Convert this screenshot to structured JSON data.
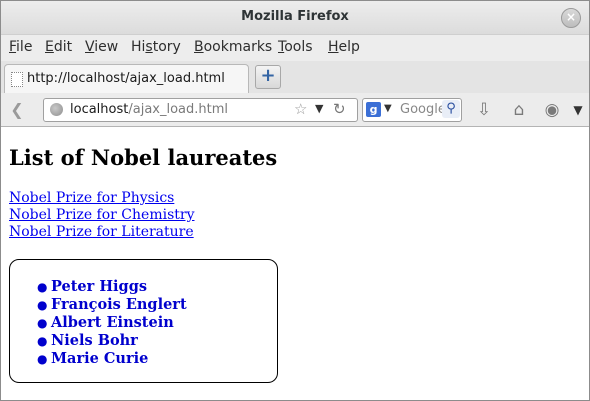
{
  "window": {
    "title": "Mozilla Firefox",
    "close_glyph": "×"
  },
  "menubar": {
    "items": [
      {
        "u": "F",
        "rest": "ile"
      },
      {
        "u": "E",
        "rest": "dit"
      },
      {
        "u": "V",
        "rest": "iew"
      },
      {
        "pre": "Hi",
        "u": "s",
        "rest": "tory"
      },
      {
        "u": "B",
        "rest": "ookmarks"
      },
      {
        "u": "T",
        "rest": "ools"
      },
      {
        "u": "H",
        "rest": "elp"
      }
    ]
  },
  "tabs": [
    {
      "label": "http://localhost/ajax_load.html"
    }
  ],
  "new_tab_glyph": "+",
  "navbar": {
    "url_host": "localhost",
    "url_path": "/ajax_load.html",
    "search_placeholder": "Google",
    "search_engine_glyph": "g"
  },
  "icons": {
    "back": "back-arrow-icon",
    "globe": "globe-icon",
    "bookmark_star": "star-icon",
    "reload": "reload-icon",
    "search": "search-icon",
    "download": "download-icon",
    "home": "home-icon",
    "addon": "puzzle-icon",
    "menu": "chevron-down-icon"
  },
  "page": {
    "heading": "List of Nobel laureates",
    "links": [
      "Nobel Prize for Physics",
      "Nobel Prize for Chemistry",
      "Nobel Prize for Literature"
    ],
    "laureates": [
      "Peter Higgs",
      "François Englert",
      "Albert Einstein",
      "Niels Bohr",
      "Marie Curie"
    ]
  },
  "colors": {
    "link": "#0000ee",
    "laureate": "#0000cd",
    "accent": "#3465a4"
  }
}
